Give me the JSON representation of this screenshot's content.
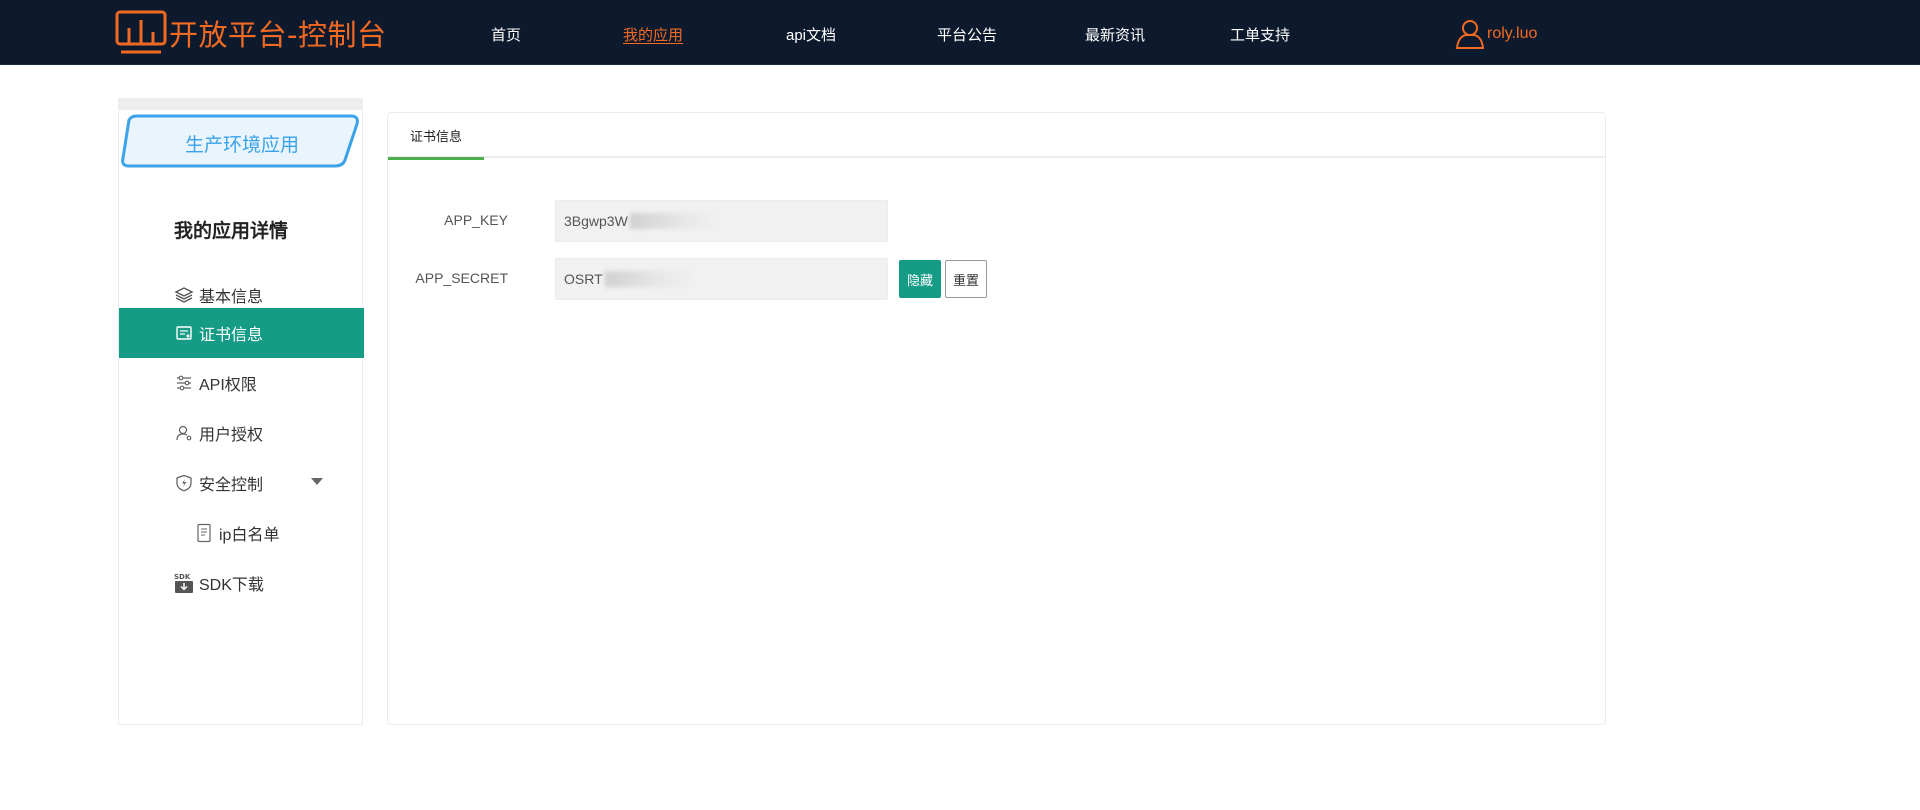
{
  "colors": {
    "nav_bg": "#0d1a2e",
    "brand": "#f26a21",
    "accent": "#169b86",
    "env_badge": "#3aa3ea",
    "tab_indicator": "#4cae4c"
  },
  "header": {
    "logo_text": "开放平台-控制台",
    "nav": [
      {
        "label": "首页",
        "active": false
      },
      {
        "label": "我的应用",
        "active": true
      },
      {
        "label": "api文档",
        "active": false
      },
      {
        "label": "平台公告",
        "active": false
      },
      {
        "label": "最新资讯",
        "active": false
      },
      {
        "label": "工单支持",
        "active": false
      }
    ],
    "user_name": "roly.luo",
    "user_icon": "user-icon"
  },
  "sidebar": {
    "env_badge": "生产环境应用",
    "title": "我的应用详情",
    "items": [
      {
        "label": "基本信息",
        "icon": "layers-icon",
        "active": false
      },
      {
        "label": "证书信息",
        "icon": "certificate-icon",
        "active": true
      },
      {
        "label": "API权限",
        "icon": "sliders-icon",
        "active": false
      },
      {
        "label": "用户授权",
        "icon": "user-key-icon",
        "active": false
      },
      {
        "label": "安全控制",
        "icon": "shield-icon",
        "active": false,
        "expanded": true
      },
      {
        "label": "ip白名单",
        "icon": "document-icon",
        "active": false,
        "sub": true
      },
      {
        "label": "SDK下载",
        "icon": "sdk-download-icon",
        "active": false
      }
    ]
  },
  "main": {
    "tabs": [
      {
        "label": "证书信息",
        "active": true
      }
    ],
    "fields": {
      "app_key": {
        "label": "APP_KEY",
        "value": "3Bgwp3W"
      },
      "app_secret": {
        "label": "APP_SECRET",
        "value": "OSRT"
      }
    },
    "buttons": {
      "hide": "隐藏",
      "reset": "重置"
    }
  }
}
